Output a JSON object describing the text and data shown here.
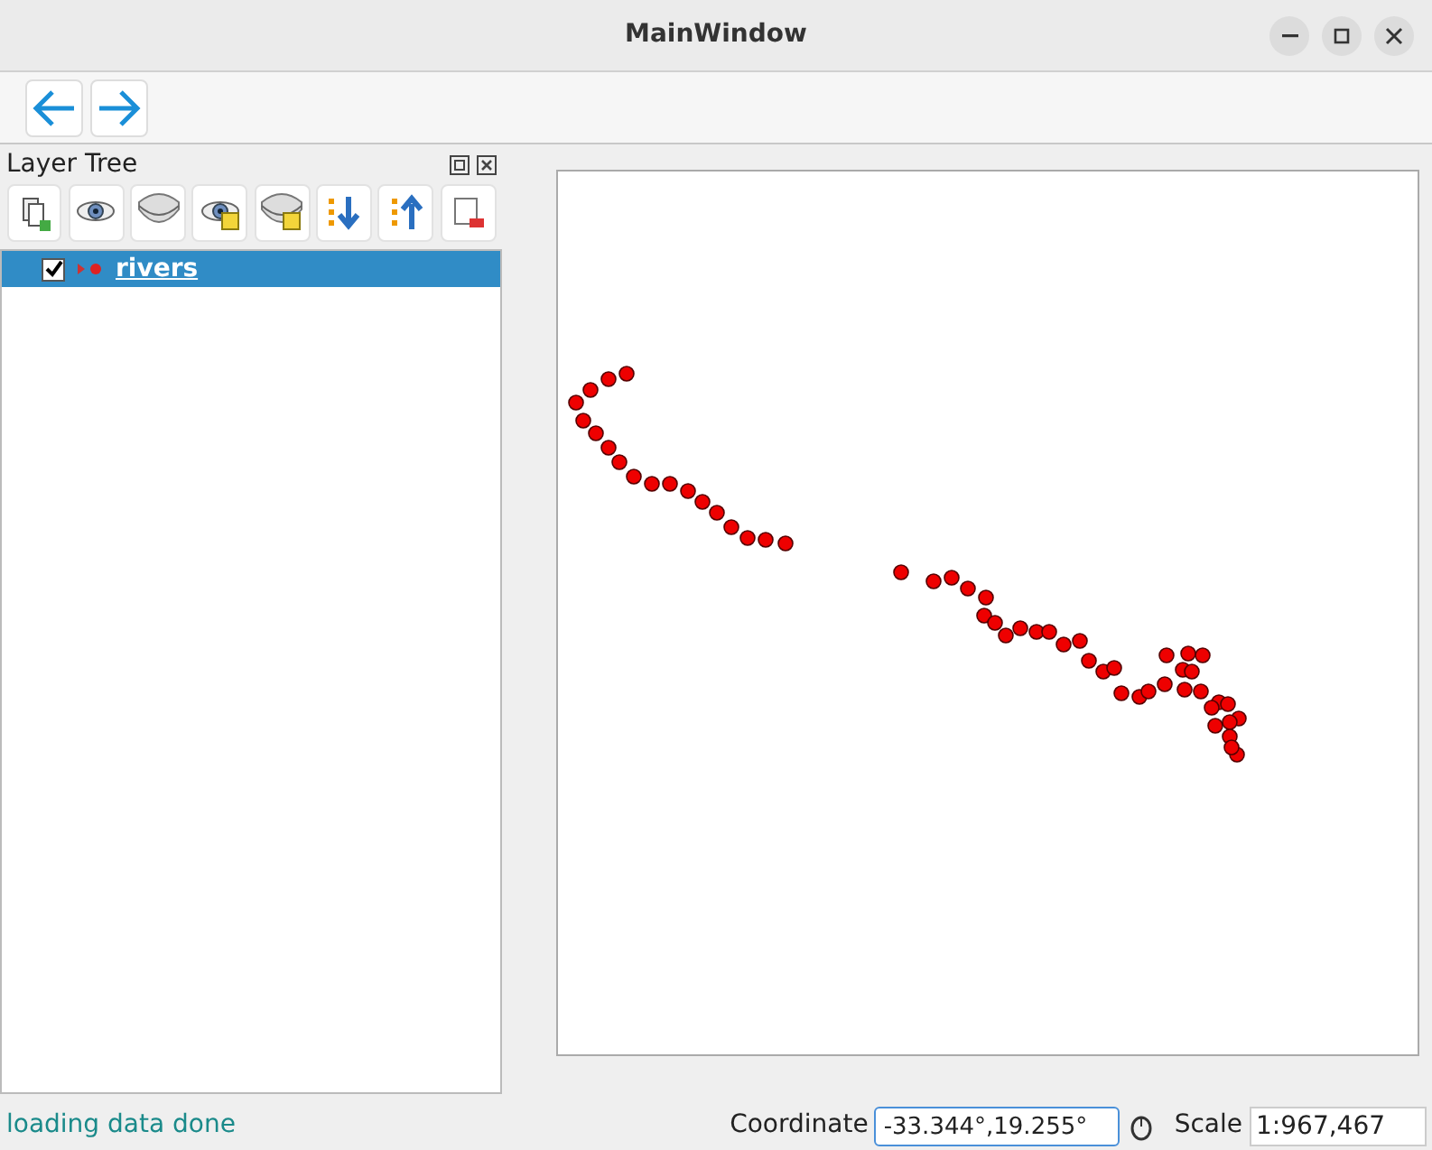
{
  "window": {
    "title": "MainWindow"
  },
  "layer_tree": {
    "title": "Layer Tree",
    "layers": [
      {
        "name": "rivers",
        "checked": true,
        "selected": true
      }
    ]
  },
  "status_bar": {
    "message": "loading data done",
    "coordinate_label": "Coordinate",
    "coordinate_value": "-33.344°,19.255°",
    "scale_label": "Scale",
    "scale_value": "1:967,467"
  }
}
